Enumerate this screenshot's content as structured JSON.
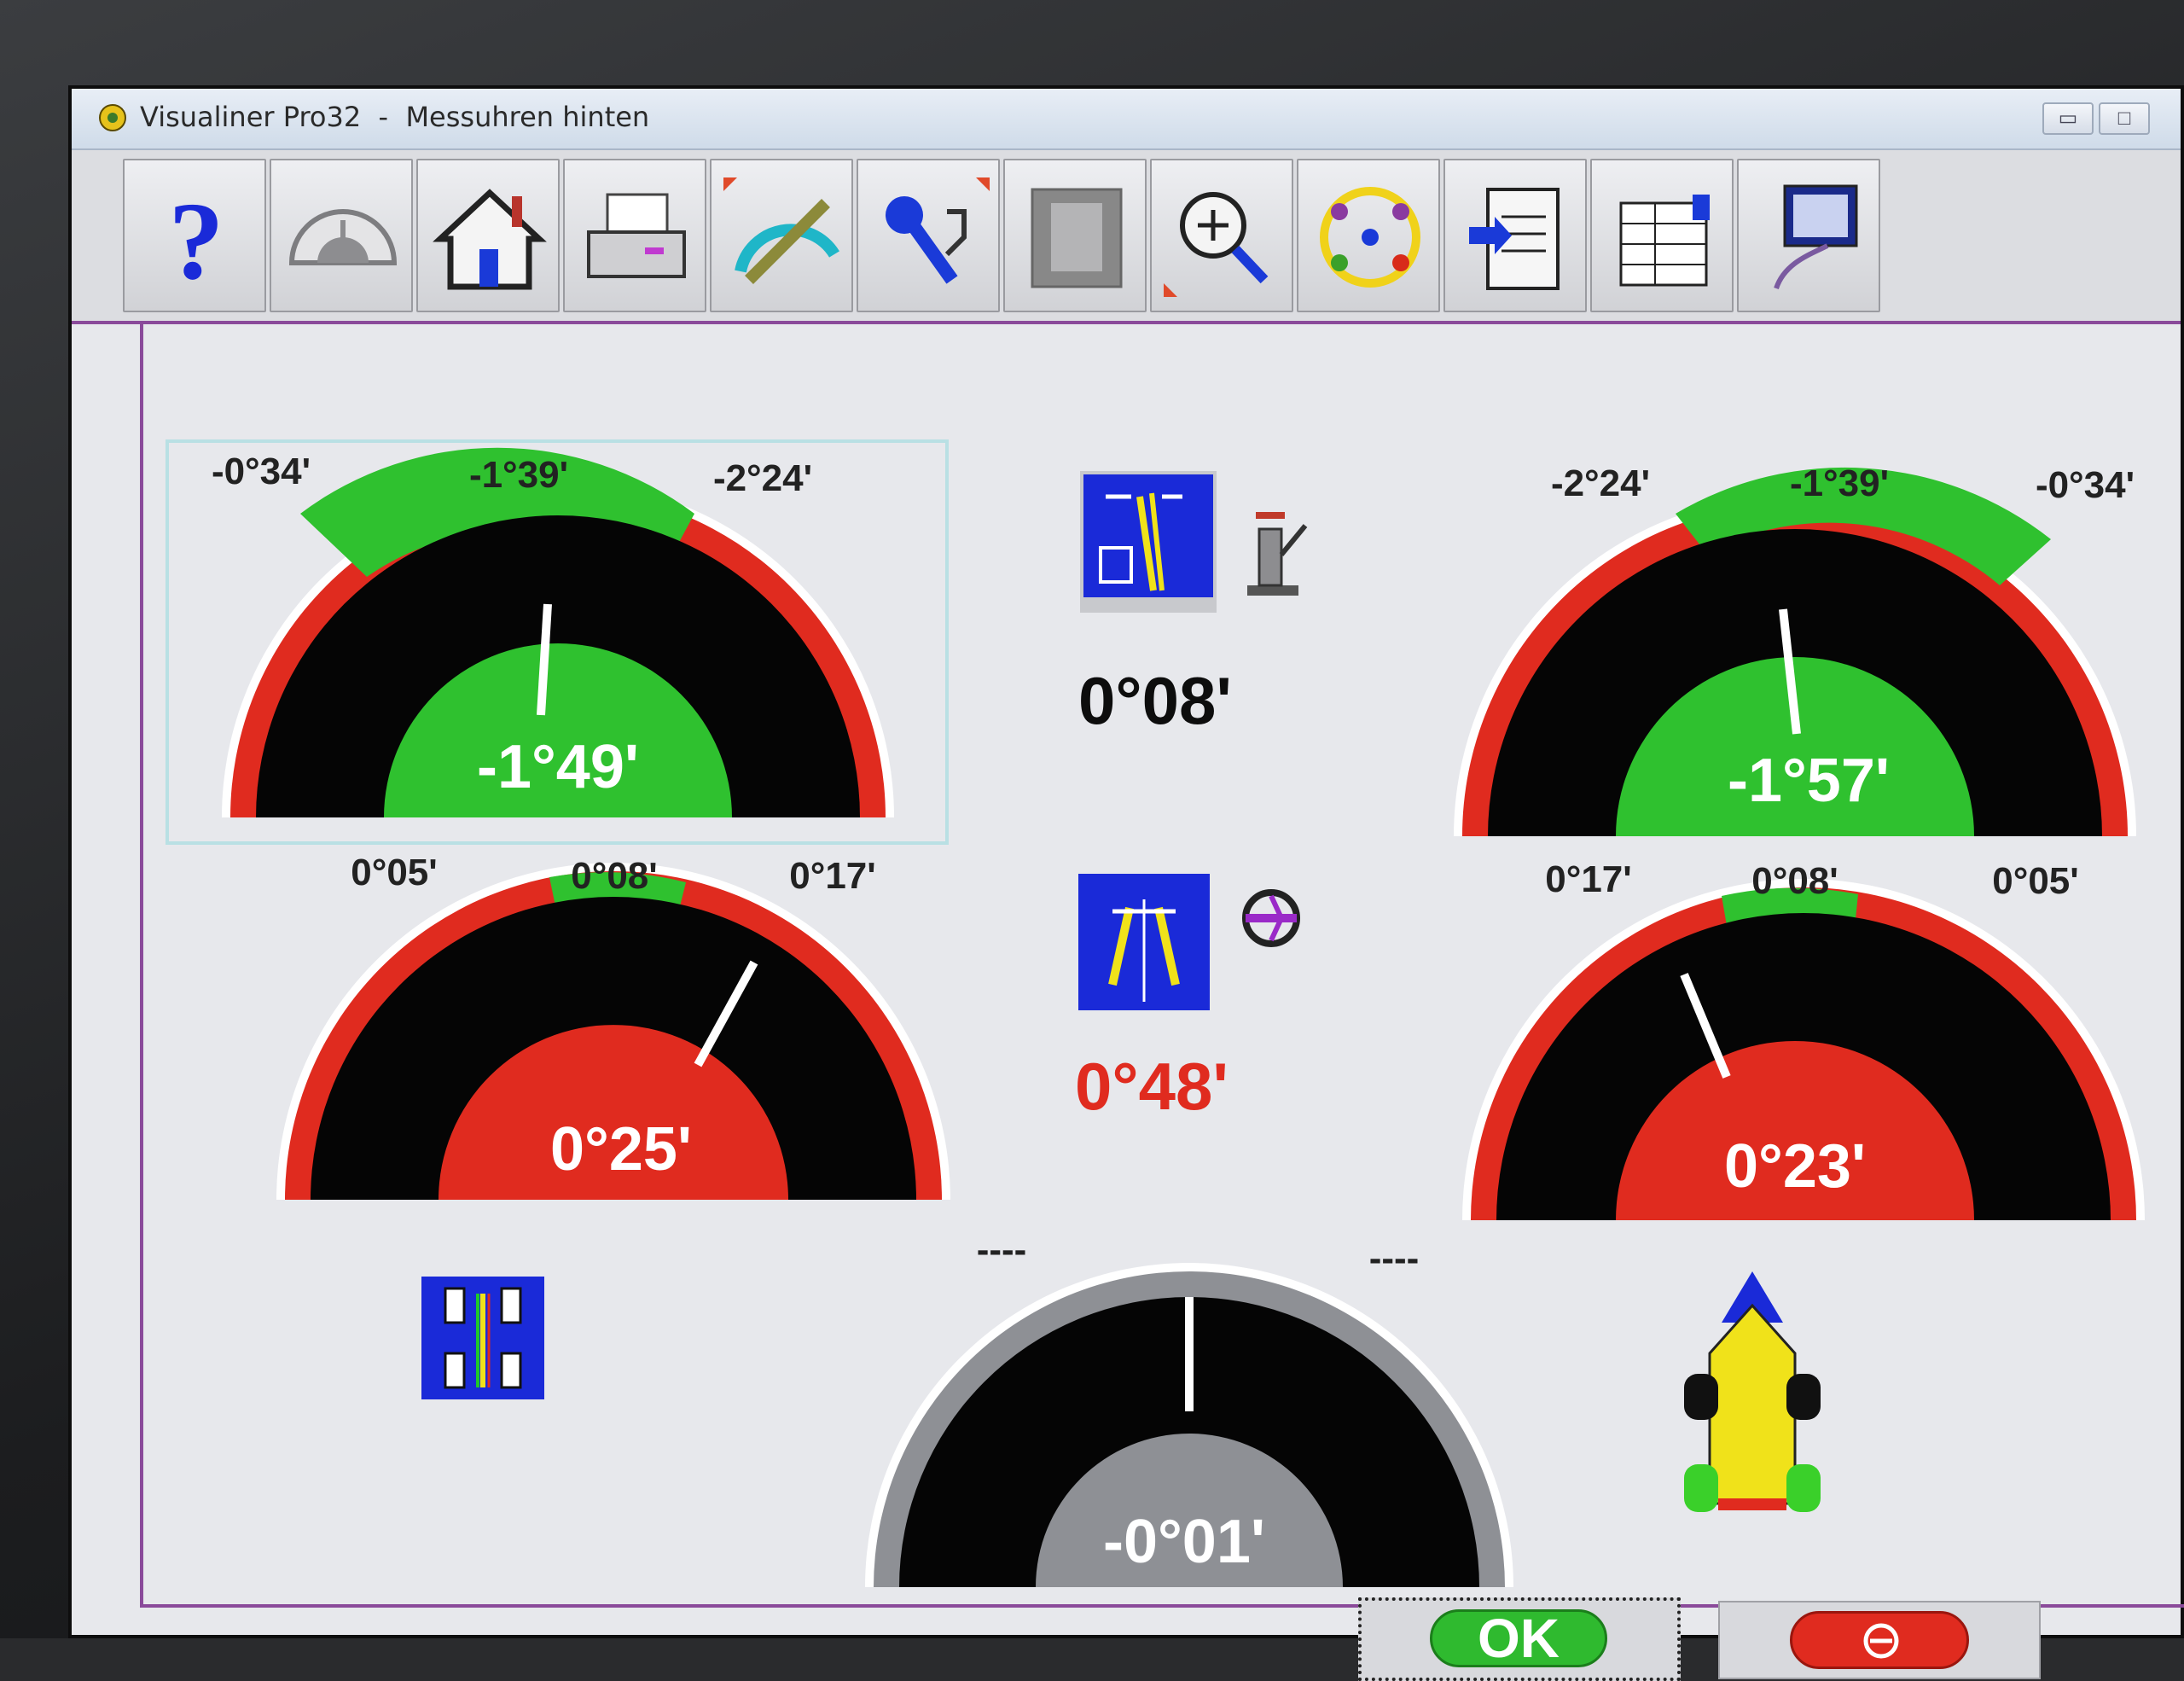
{
  "window": {
    "title": "Visualiner Pro32  -  Messuhren hinten",
    "minimize": "▭",
    "maximize": "□"
  },
  "toolbar": {
    "buttons": [
      {
        "name": "help",
        "icon": "question-mark-icon"
      },
      {
        "name": "speedometer",
        "icon": "speedometer-icon"
      },
      {
        "name": "home",
        "icon": "home-icon"
      },
      {
        "name": "print",
        "icon": "printer-icon"
      },
      {
        "name": "measure",
        "icon": "protractor-ruler-icon"
      },
      {
        "name": "adjust",
        "icon": "wrench-icon"
      },
      {
        "name": "film",
        "icon": "film-strip-icon"
      },
      {
        "name": "zoom",
        "icon": "magnifier-plus-icon"
      },
      {
        "name": "sequence",
        "icon": "procedure-chain-icon"
      },
      {
        "name": "clipboard",
        "icon": "clipboard-arrow-icon"
      },
      {
        "name": "datasheet",
        "icon": "spreadsheet-hand-icon"
      },
      {
        "name": "print-report",
        "icon": "report-printout-icon"
      }
    ]
  },
  "gauges": {
    "camber_left": {
      "min_label": "-0°34'",
      "target_label": "-1°39'",
      "max_label": "-2°24'",
      "value": "-1°49'",
      "status": "ok"
    },
    "camber_right": {
      "min_label": "-2°24'",
      "target_label": "-1°39'",
      "max_label": "-0°34'",
      "value": "-1°57'",
      "status": "ok"
    },
    "toe_left": {
      "min_label": "0°05'",
      "target_label": "0°08'",
      "max_label": "0°17'",
      "value": "0°25'",
      "status": "out"
    },
    "toe_right": {
      "min_label": "0°17'",
      "target_label": "0°08'",
      "max_label": "0°05'",
      "value": "0°23'",
      "status": "out"
    },
    "thrust_angle": {
      "min_label": "----",
      "max_label": "----",
      "value": "-0°01'",
      "status": "none"
    }
  },
  "center": {
    "camber_diff": "0°08'",
    "total_toe": "0°48'"
  },
  "buttons": {
    "ok": "OK",
    "cancel_icon": "no-entry-icon"
  },
  "colors": {
    "ok_green": "#2fc12f",
    "out_red": "#e02b1f",
    "gauge_black": "#050505",
    "neutral_gray": "#8e9095",
    "accent_purple": "#8a4a9a"
  }
}
